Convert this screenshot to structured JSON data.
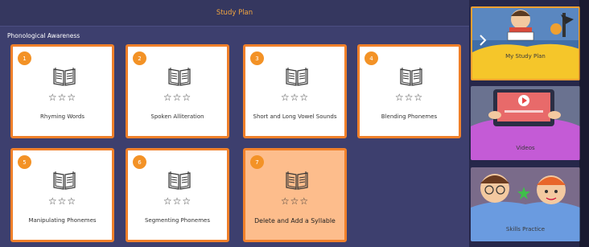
{
  "header": {
    "title": "Study Plan"
  },
  "section": {
    "title": "Phonological Awareness"
  },
  "lessons": [
    {
      "number": "1",
      "label": "Rhyming Words",
      "stars": "☆☆☆"
    },
    {
      "number": "2",
      "label": "Spoken Alliteration",
      "stars": "☆☆☆"
    },
    {
      "number": "3",
      "label": "Short and Long Vowel Sounds",
      "stars": "☆☆☆"
    },
    {
      "number": "4",
      "label": "Blending Phonemes",
      "stars": "☆☆☆"
    },
    {
      "number": "5",
      "label": "Manipulating Phonemes",
      "stars": "☆☆☆"
    },
    {
      "number": "6",
      "label": "Segmenting Phonemes",
      "stars": "☆☆☆"
    },
    {
      "number": "7",
      "label": "Delete and Add a Syllable",
      "stars": "☆☆☆",
      "state": "selected"
    }
  ],
  "sidebar": {
    "items": [
      {
        "label": "My Study Plan",
        "state": "selected"
      },
      {
        "label": "Videos"
      },
      {
        "label": "Skills Practice"
      }
    ]
  },
  "colors": {
    "accent": "#f0802a",
    "header_text": "#f2a640",
    "background": "#3d3f6e",
    "selected_card": "#fdbd8c",
    "tile_yellow": "#f5c62a",
    "tile_purple": "#c45bd6",
    "tile_blue": "#6a9be0"
  }
}
